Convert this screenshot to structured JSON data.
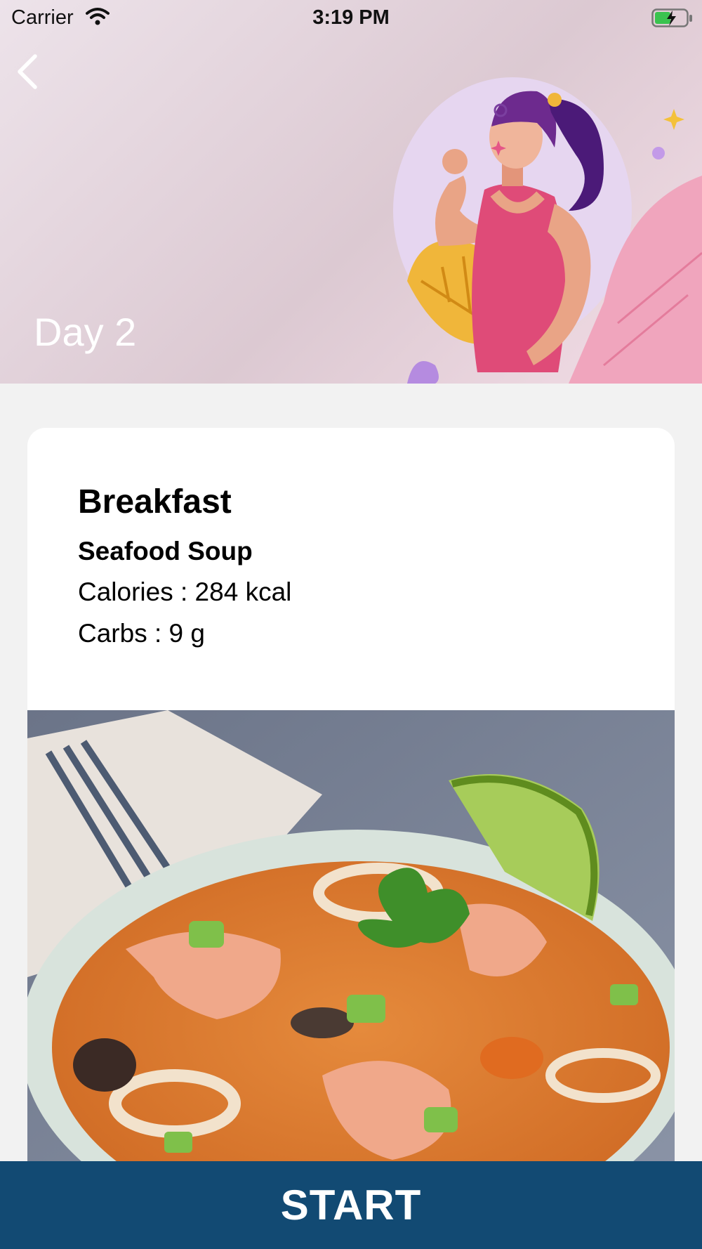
{
  "status_bar": {
    "carrier": "Carrier",
    "time": "3:19 PM"
  },
  "header": {
    "day_title": "Day 2"
  },
  "meal": {
    "type": "Breakfast",
    "dish": "Seafood Soup",
    "calories": "Calories : 284 kcal",
    "carbs": "Carbs : 9 g"
  },
  "footer": {
    "start_label": "START"
  },
  "colors": {
    "start_bar": "#124a73",
    "card": "#ffffff",
    "page_bg": "#f2f2f2"
  }
}
